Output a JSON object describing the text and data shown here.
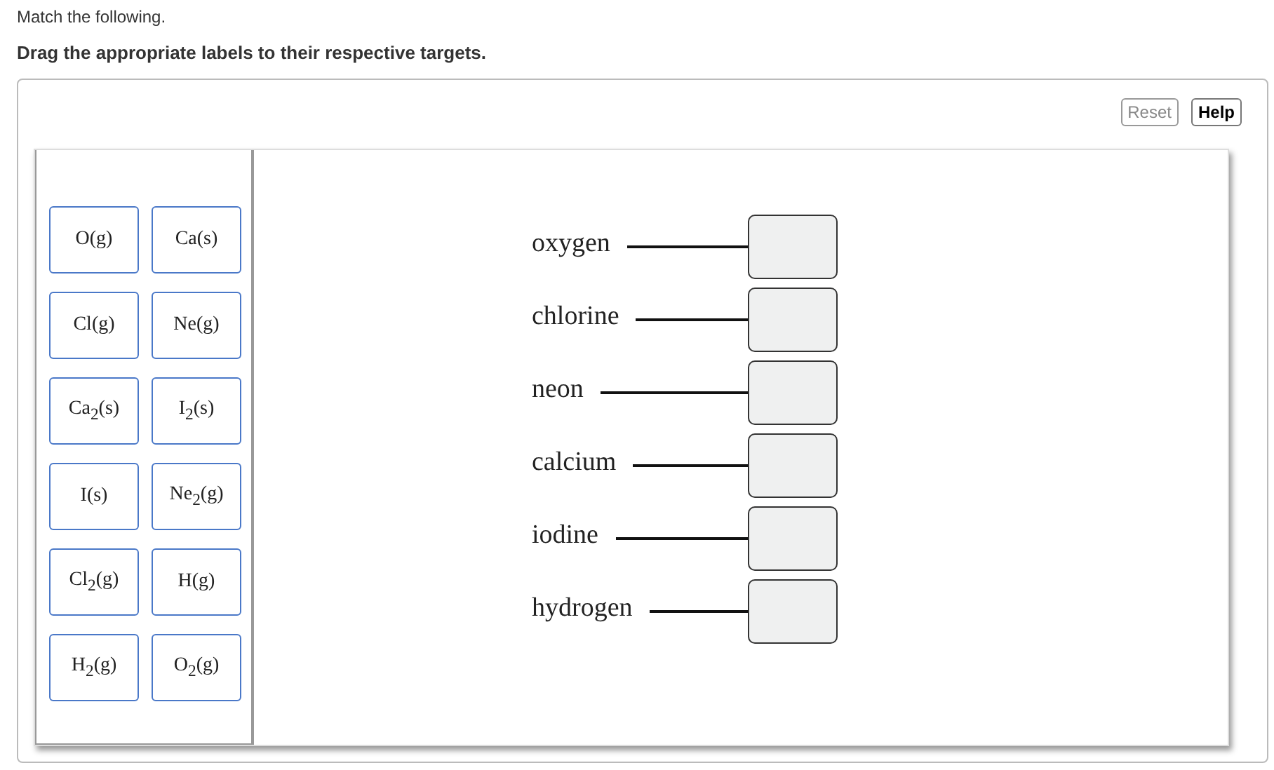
{
  "prompt": "Match the following.",
  "instruction": "Drag the appropriate labels to their respective targets.",
  "buttons": [
    {
      "label": "Reset",
      "disabled": true
    },
    {
      "label": "Help",
      "disabled": false
    }
  ],
  "labels": [
    {
      "text": "O(g)"
    },
    {
      "text": "Ca(s)"
    },
    {
      "text": "Cl(g)"
    },
    {
      "text": "Ne(g)"
    },
    {
      "text": "Ca$_{2}$(s)"
    },
    {
      "text": "I$_{2}$(s)"
    },
    {
      "text": "I(s)"
    },
    {
      "text": "Ne$_{2}$(g)"
    },
    {
      "text": "Cl$_{2}$(g)"
    },
    {
      "text": "H(g)"
    },
    {
      "text": "H$_{2}$(g)"
    },
    {
      "text": "O$_{2}$(g)"
    }
  ],
  "targets": [
    {
      "term": "oxygen"
    },
    {
      "term": "chlorine"
    },
    {
      "term": "neon"
    },
    {
      "term": "calcium"
    },
    {
      "term": "iodine"
    },
    {
      "term": "hydrogen"
    }
  ]
}
